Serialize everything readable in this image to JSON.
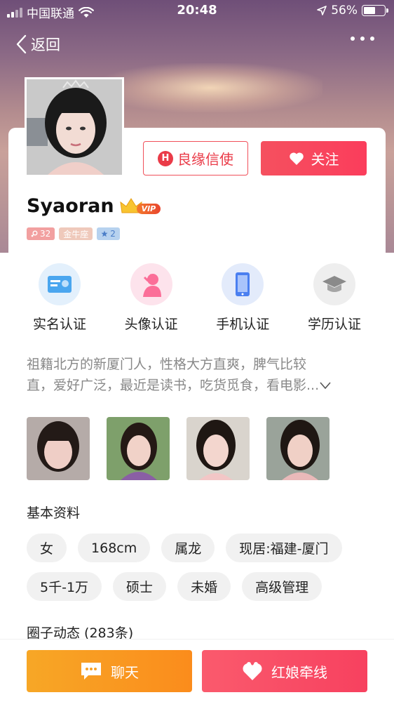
{
  "status_bar": {
    "carrier": "中国联通",
    "time": "20:48",
    "battery": "56%"
  },
  "nav": {
    "back_label": "返回"
  },
  "profile": {
    "name": "Syaoran",
    "vip_label": "VIP",
    "badges": {
      "age": "32",
      "zodiac": "金牛座",
      "stars": "2"
    }
  },
  "actions": {
    "matchmaker_label": "良缘信使",
    "follow_label": "关注"
  },
  "certifications": [
    {
      "label": "实名认证",
      "icon": "id-card-icon"
    },
    {
      "label": "头像认证",
      "icon": "avatar-verify-icon"
    },
    {
      "label": "手机认证",
      "icon": "phone-icon"
    },
    {
      "label": "学历认证",
      "icon": "graduation-cap-icon"
    }
  ],
  "intro": {
    "line1": "祖籍北方的新厦门人，性格大方直爽，脾气比较",
    "line2": "直，爱好广泛，最近是读书，吃货觅食，看电影...",
    "expand_icon": "chevron-down-icon"
  },
  "basic_info": {
    "title": "基本资料",
    "tags": [
      "女",
      "168cm",
      "属龙",
      "现居:福建-厦门",
      "5千-1万",
      "硕士",
      "未婚",
      "高级管理"
    ]
  },
  "moments": {
    "title": "圈子动态 (283条)"
  },
  "bottom_bar": {
    "chat_label": "聊天",
    "matchmaker_label": "红娘牵线"
  },
  "colors": {
    "accent_red": "#f5505f",
    "accent_orange": "#f7a726"
  }
}
